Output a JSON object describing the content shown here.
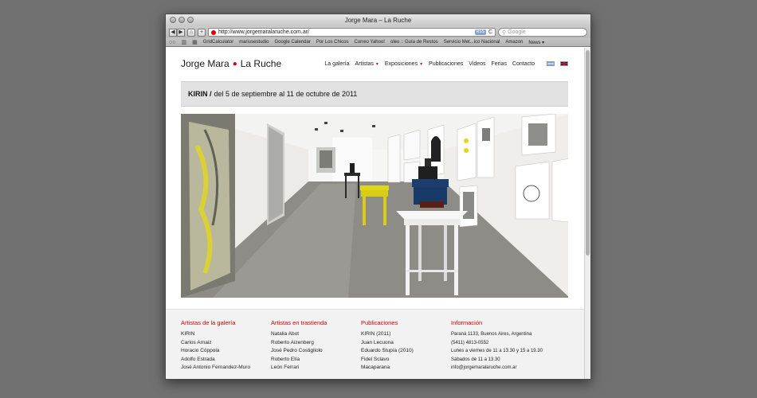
{
  "window": {
    "title": "Jorge Mara – La Ruche"
  },
  "toolbar": {
    "back": "◀",
    "forward": "▶",
    "home": "⌂",
    "add": "+",
    "url": "http://www.jorgemaralaruche.com.ar/",
    "rss": "RSS",
    "reload": "C",
    "search_placeholder": "Google"
  },
  "bookmarks": [
    "GridCalculator",
    "mariusestudio",
    "Google Calendar",
    "Por Los Chicos",
    "Correo Yahoo!",
    "oleo :: Guía de Restos",
    "Servicio Met...ico Nacional",
    "Amazon",
    "News ▾"
  ],
  "site": {
    "logo_left": "Jorge Mara",
    "logo_dot": "●",
    "logo_right": "La Ruche",
    "nav": [
      {
        "label": "La galería",
        "caret": ""
      },
      {
        "label": "Artistas",
        "caret": "▼"
      },
      {
        "label": "Exposiciones",
        "caret": "▼"
      },
      {
        "label": "Publicaciones",
        "caret": ""
      },
      {
        "label": "Videos",
        "caret": ""
      },
      {
        "label": "Ferias",
        "caret": ""
      },
      {
        "label": "Contacto",
        "caret": ""
      }
    ]
  },
  "banner": {
    "title": "KIRIN /",
    "dates": "del 5 de septiembre al 11 de octubre de 2011"
  },
  "footer": {
    "col1": {
      "heading": "Artistas de la galería",
      "items": [
        "KIRIN",
        "Carlos Arnaiz",
        "Horacio Cóppola",
        "Adolfo Estrada",
        "José Antonio Fernandez-Muro"
      ]
    },
    "col2": {
      "heading": "Artistas en trastienda",
      "items": [
        "Natalia Abot",
        "Roberto Aizenberg",
        "José Pedro Costigliolo",
        "Roberto Elía",
        "León Ferrari"
      ]
    },
    "col3": {
      "heading": "Publicaciones",
      "items": [
        "KIRIN (2011)",
        "Juan Lecuona",
        "Eduardo Stupía (2010)",
        "Fidel Sclavo",
        "Macaparana"
      ]
    },
    "col4": {
      "heading": "Información",
      "items": [
        "Paraná 1133, Buenos Aires, Argentina",
        "(5411) 4813-0552",
        "Lunes a viernes de 11 a 13.30 y 15 a 19.30",
        "Sábados de 11 a 13.30",
        "info@jorgemaralaruche.com.ar"
      ]
    }
  },
  "colors": {
    "accent": "#d40000",
    "desktop": "#717171",
    "banner_bg": "#e2e2e2",
    "footer_bg": "#f2f2f2"
  }
}
